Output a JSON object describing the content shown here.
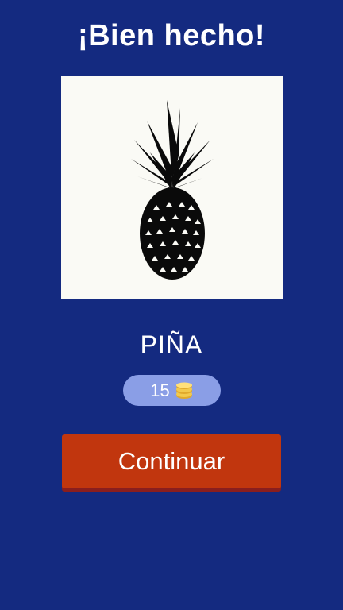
{
  "header": {
    "title": "¡Bien hecho!"
  },
  "puzzle": {
    "image_icon": "pineapple-silhouette-icon",
    "answer": "PIÑA"
  },
  "reward": {
    "amount": "15",
    "icon": "coins-icon",
    "coin_color": "#f2c94c"
  },
  "actions": {
    "continue_label": "Continuar"
  },
  "colors": {
    "background": "#142a80",
    "button": "#c1360e",
    "pill": "#8a9ee6"
  }
}
